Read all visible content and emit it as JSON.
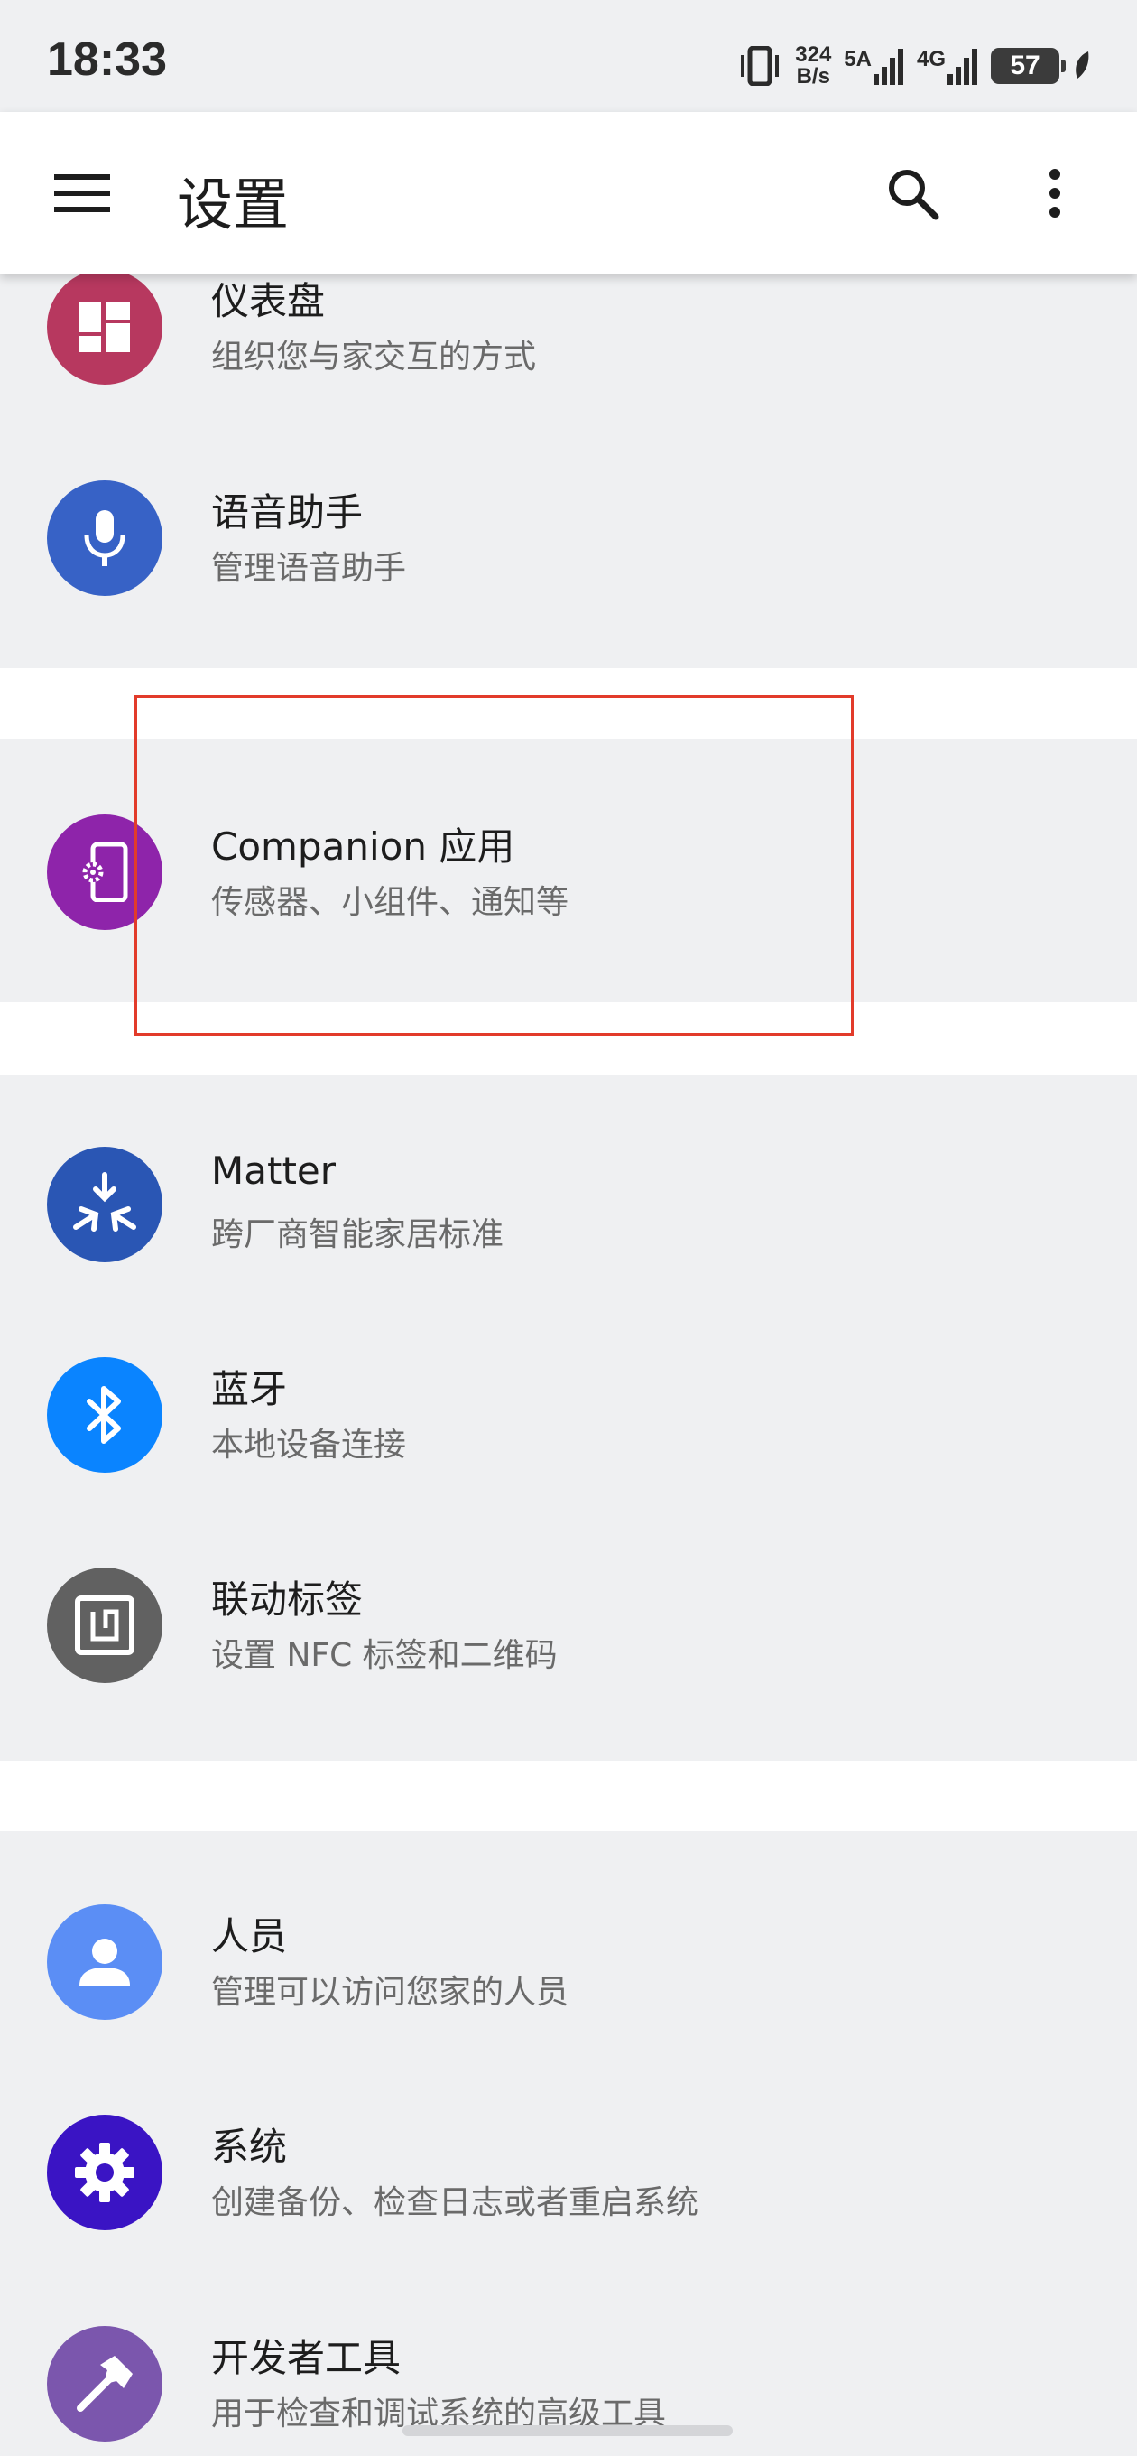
{
  "status_bar": {
    "time": "18:33",
    "net_speed_value": "324",
    "net_speed_unit": "B/s",
    "signal1_label": "5A",
    "signal2_label": "4G",
    "battery": "57"
  },
  "app_bar": {
    "title": "设置",
    "icons": [
      "menu-icon",
      "search-icon",
      "more-vert-icon"
    ]
  },
  "items": [
    {
      "title": "仪表盘",
      "subtitle": "组织您与家交互的方式",
      "icon": "dashboard-icon",
      "color": "#b7385f"
    },
    {
      "title": "语音助手",
      "subtitle": "管理语音助手",
      "icon": "microphone-icon",
      "color": "#3762c6"
    },
    {
      "title": "Companion 应用",
      "subtitle": "传感器、小组件、通知等",
      "icon": "companion-app-icon",
      "color": "#8e24aa"
    },
    {
      "title": "Matter",
      "subtitle": "跨厂商智能家居标准",
      "icon": "matter-icon",
      "color": "#2a56b4"
    },
    {
      "title": "蓝牙",
      "subtitle": "本地设备连接",
      "icon": "bluetooth-icon",
      "color": "#0a84ff"
    },
    {
      "title": "联动标签",
      "subtitle": "设置 NFC 标签和二维码",
      "icon": "nfc-tag-icon",
      "color": "#616161"
    },
    {
      "title": "人员",
      "subtitle": "管理可以访问您家的人员",
      "icon": "person-icon",
      "color": "#5b8ef5"
    },
    {
      "title": "系统",
      "subtitle": "创建备份、检查日志或者重启系统",
      "icon": "gear-icon",
      "color": "#3a14c4"
    },
    {
      "title": "开发者工具",
      "subtitle": "用于检查和调试系统的高级工具",
      "icon": "hammer-icon",
      "color": "#7b56ad"
    }
  ]
}
